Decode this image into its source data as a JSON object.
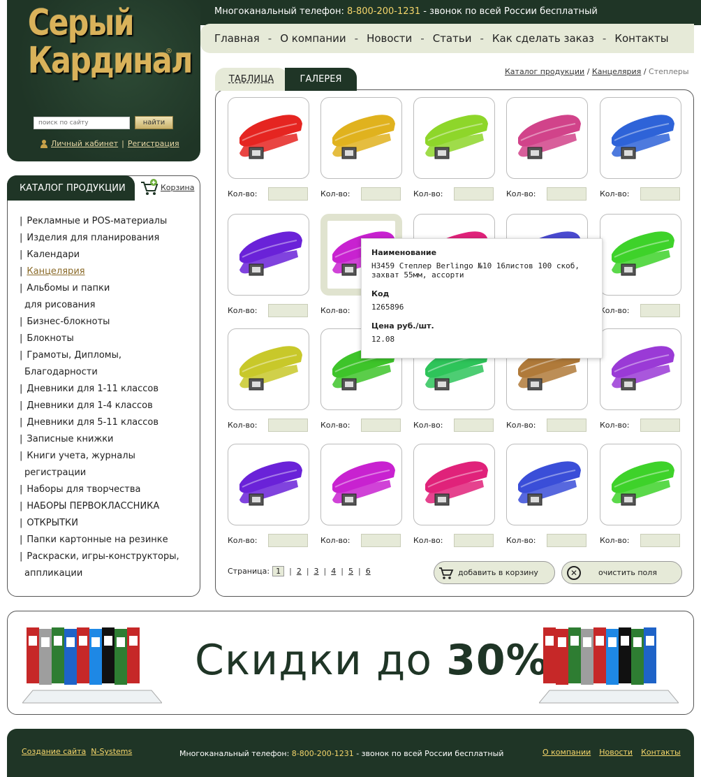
{
  "header": {
    "logo_line1": "Серый",
    "logo_line2": "Кардинал",
    "logo_reg": "®",
    "phone_label": "Многоканальный телефон:",
    "phone_number": "8-800-200-1231",
    "phone_note": "- звонок по всей России бесплатный",
    "search_placeholder": "поиск по сайту",
    "search_button": "найти",
    "account_link": "Личный кабинет",
    "register_link": "Регистрация"
  },
  "nav": [
    "Главная",
    "О компании",
    "Новости",
    "Статьи",
    "Как сделать заказ",
    "Контакты"
  ],
  "sidebar": {
    "title": "КАТАЛОГ ПРОДУКЦИИ",
    "cart_label": "Корзина",
    "items": [
      {
        "label": "Рекламные и POS-материалы"
      },
      {
        "label": "Изделия для планирования"
      },
      {
        "label": "Календари"
      },
      {
        "label": "Канцелярия",
        "active": true
      },
      {
        "label": "Альбомы и папки",
        "cont": "для рисования"
      },
      {
        "label": "Бизнес-блокноты"
      },
      {
        "label": "Блокноты"
      },
      {
        "label": "Грамоты, Дипломы,",
        "cont": "Благодарности"
      },
      {
        "label": "Дневники для 1-11 классов"
      },
      {
        "label": "Дневники для 1-4 классов"
      },
      {
        "label": "Дневники для 5-11 классов"
      },
      {
        "label": "Записные книжки"
      },
      {
        "label": "Книги учета, журналы",
        "cont": " регистрации"
      },
      {
        "label": "Наборы для творчества"
      },
      {
        "label": "НАБОРЫ ПЕРВОКЛАССНИКА"
      },
      {
        "label": "ОТКРЫТКИ"
      },
      {
        "label": "Папки картонные на резинке"
      },
      {
        "label": "Раскраски, игры-конструкторы,",
        "cont": "аппликации"
      }
    ]
  },
  "main": {
    "tab_table": "ТАБЛИЦА",
    "tab_gallery": "ГАЛЕРЕЯ",
    "breadcrumb": [
      "Каталог продукции",
      "Канцелярия",
      "Степлеры"
    ],
    "breadcrumb_sep": "/",
    "qty_label": "Кол-во:",
    "products": [
      {
        "color": "#e52521"
      },
      {
        "color": "#e0b21e"
      },
      {
        "color": "#8ed62a"
      },
      {
        "color": "#d1438a"
      },
      {
        "color": "#2e63d8"
      },
      {
        "color": "#6a22d8"
      },
      {
        "color": "#c822d0",
        "highlight": true
      },
      {
        "color": "#e0227a"
      },
      {
        "color": "#4a4ad0"
      },
      {
        "color": "#3ed22a"
      },
      {
        "color": "#c8c82a"
      },
      {
        "color": "#3ec42a"
      },
      {
        "color": "#2ec45a"
      },
      {
        "color": "#b07a3a"
      },
      {
        "color": "#9a3ad6"
      },
      {
        "color": "#6a22d8"
      },
      {
        "color": "#c822d0"
      },
      {
        "color": "#e0227a"
      },
      {
        "color": "#3a4ed8"
      },
      {
        "color": "#3ed22a"
      }
    ],
    "tooltip": {
      "name_label": "Наименование",
      "name_value": "Н3459 Степлер Berlingo №10 16листов 100 скоб, захват 55мм, ассорти",
      "code_label": "Код",
      "code_value": "1265896",
      "price_label": "Цена руб./шт.",
      "price_value": "12.08"
    },
    "pager_label": "Страница:",
    "pages": [
      "1",
      "2",
      "3",
      "4",
      "5",
      "6"
    ],
    "current_page": "1",
    "add_to_cart": "добавить в корзину",
    "clear_fields": "очистить поля"
  },
  "promo": {
    "text_normal": "Скидки до ",
    "text_bold": "30%"
  },
  "footer": {
    "create_label": "Создание сайта",
    "create_company": "N-Systems",
    "phone_label": "Многоканальный телефон:",
    "phone_number": "8-800-200-1231",
    "phone_note": "- звонок по всей России бесплатный",
    "links": [
      "О компании",
      "Новости",
      "Контакты"
    ]
  },
  "colors": {
    "dark_green": "#1f3526",
    "light_green": "#e6ead8",
    "gold": "#d9b25a",
    "yellow": "#f5d66b"
  }
}
